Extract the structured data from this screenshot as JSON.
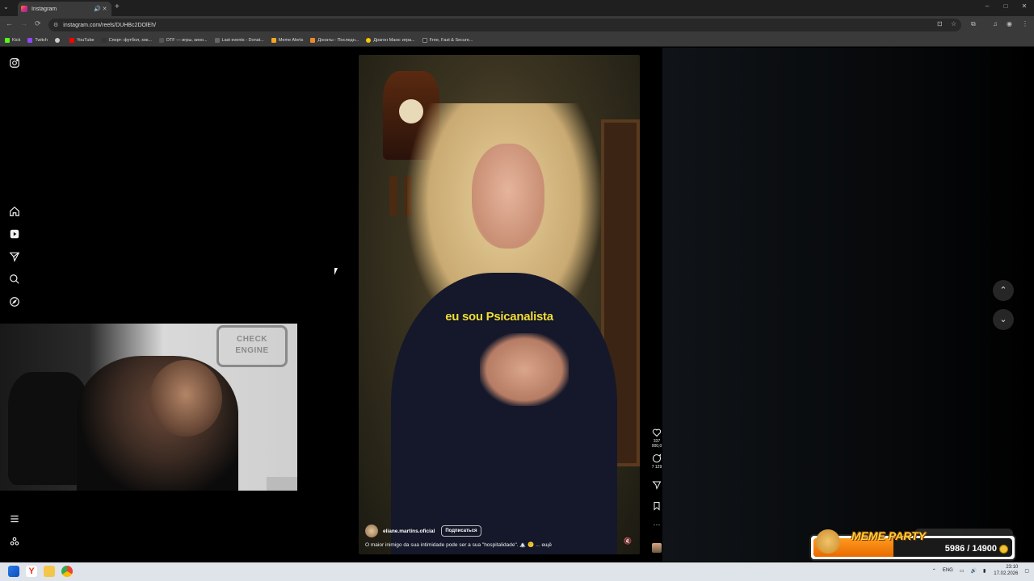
{
  "browser": {
    "tab_title": "Instagram",
    "url": "instagram.com/reels/DUHBc2DOlEh/",
    "new_tab": "+",
    "window_controls": [
      "–",
      "□",
      "✕"
    ],
    "bookmarks": [
      {
        "label": "Kick",
        "color": "#53fc18"
      },
      {
        "label": "Twitch",
        "color": "#9146ff"
      },
      {
        "label": "",
        "color": "#cccccc"
      },
      {
        "label": "YouTube",
        "color": "#ff0000"
      },
      {
        "label": "Спорт: футбол, хок...",
        "color": "#222222"
      },
      {
        "label": "DTF — игры, кино...",
        "color": "#333333"
      },
      {
        "label": "Last events - Donat...",
        "color": "#444444"
      },
      {
        "label": "Meme Alerts",
        "color": "#f5a623"
      },
      {
        "label": "Донаты - Последн...",
        "color": "#f08a24"
      },
      {
        "label": "Драгон Манк: игра...",
        "color": "#f7c800"
      },
      {
        "label": "Free, Fast & Secure...",
        "color": "#2a2a2a"
      }
    ]
  },
  "sidebar": {
    "items": [
      {
        "name": "instagram-logo-icon"
      },
      {
        "name": "home-icon"
      },
      {
        "name": "reels-icon"
      },
      {
        "name": "send-icon"
      },
      {
        "name": "search-icon"
      },
      {
        "name": "explore-icon"
      },
      {
        "name": "menu-icon"
      },
      {
        "name": "meta-threads-icon"
      }
    ]
  },
  "reel": {
    "subtitle": "eu sou Psicanalista",
    "author": "eliane.martins.oficial",
    "follow_label": "Подписаться",
    "caption": "O maior inimigo da sua intimidade pode ser a sua \"hospitalidade\". 🏔️ 🙂 ... ещё",
    "likes": "337 000,0",
    "comments": "7 129",
    "more": "···"
  },
  "widget": {
    "label": "MEME PARTY",
    "progress_text": "5986 / 14900",
    "progress_fraction": 0.4017,
    "accent": "#ff9a1f"
  },
  "webcam": {
    "sign_text": "CHECK ENGINE"
  },
  "taskbar": {
    "lang": "ENG",
    "time": "23:10",
    "date": "17.02.2026"
  }
}
